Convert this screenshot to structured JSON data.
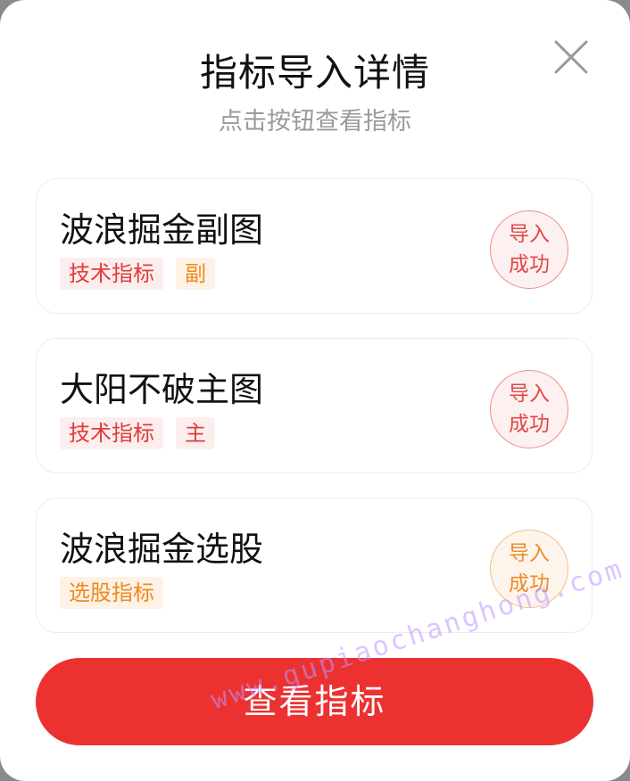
{
  "dialog": {
    "title": "指标导入详情",
    "subtitle": "点击按钮查看指标",
    "close_icon": "close-icon"
  },
  "cards": [
    {
      "title": "波浪掘金副图",
      "tags": [
        "技术指标",
        "副"
      ],
      "status_line1": "导入",
      "status_line2": "成功"
    },
    {
      "title": "大阳不破主图",
      "tags": [
        "技术指标",
        "主"
      ],
      "status_line1": "导入",
      "status_line2": "成功"
    },
    {
      "title": "波浪掘金选股",
      "tags": [
        "选股指标"
      ],
      "status_line1": "导入",
      "status_line2": "成功"
    }
  ],
  "button": {
    "label": "查看指标"
  },
  "watermark": "www.gupiaochanghong.com",
  "colors": {
    "accent_red": "#ec3131",
    "tag_orange": "#ef8a1d",
    "tag_red": "#e23b3b"
  }
}
